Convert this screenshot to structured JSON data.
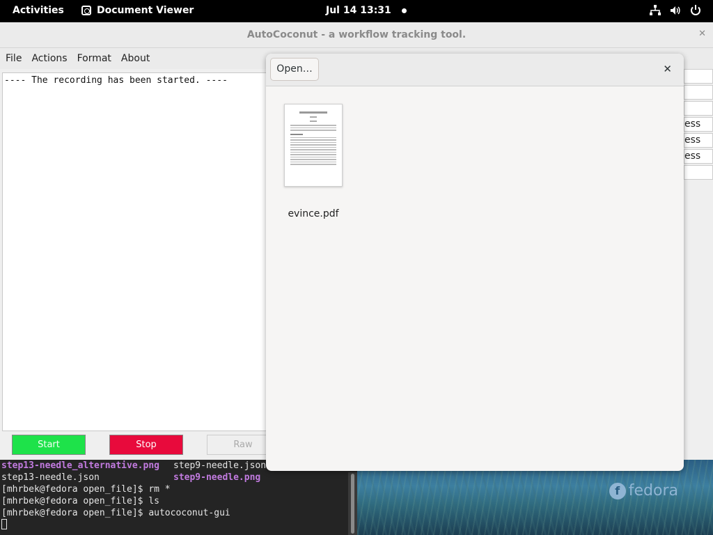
{
  "topbar": {
    "activities": "Activities",
    "app_name": "Document Viewer",
    "app_icon": "document-viewer-icon",
    "clock": "Jul 14  13:31",
    "tray_icons": [
      "network-icon",
      "volume-icon",
      "power-icon"
    ]
  },
  "autococonut": {
    "title": "AutoCoconut - a workflow tracking tool.",
    "menu": [
      "File",
      "Actions",
      "Format",
      "About"
    ],
    "log_text": "---- The recording has been started. ----",
    "buttons": {
      "start": "Start",
      "stop": "Stop",
      "raw": "Raw"
    },
    "right_rows": [
      "",
      "",
      "",
      "ess",
      "ess",
      "ess",
      ""
    ],
    "colors": {
      "start": "#1ee24a",
      "stop": "#e80a3c"
    }
  },
  "dialog": {
    "open_label": "Open…",
    "file_name": "evince.pdf",
    "close_icon": "close-icon"
  },
  "terminal": {
    "lines": [
      {
        "a": "step13-needle_alternative.png",
        "b": "step9-needle.json"
      },
      {
        "a": "step13-needle.json",
        "b": "step9-needle.png"
      }
    ],
    "commands": [
      "[mhrbek@fedora open_file]$ rm *",
      "[mhrbek@fedora open_file]$ ls",
      "[mhrbek@fedora open_file]$ autococonut-gui"
    ]
  },
  "desktop": {
    "logo_text": "fedora"
  }
}
